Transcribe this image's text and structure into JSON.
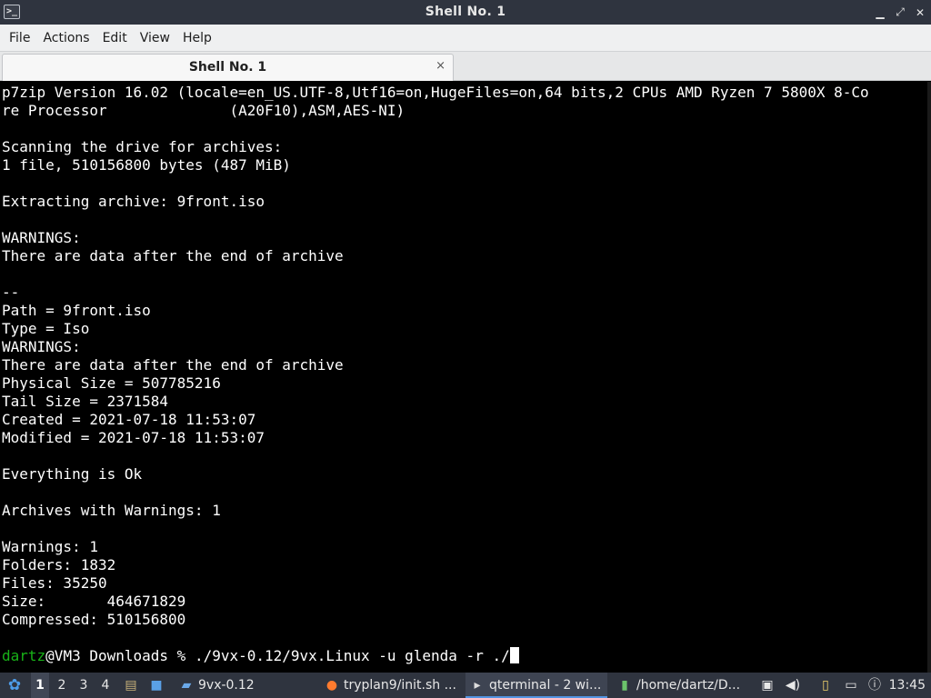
{
  "window": {
    "title": "Shell No. 1"
  },
  "menu": [
    "File",
    "Actions",
    "Edit",
    "View",
    "Help"
  ],
  "tab": {
    "label": "Shell No. 1",
    "close": "×"
  },
  "terminal": {
    "lines": [
      "p7zip Version 16.02 (locale=en_US.UTF-8,Utf16=on,HugeFiles=on,64 bits,2 CPUs AMD Ryzen 7 5800X 8-Co",
      "re Processor              (A20F10),ASM,AES-NI)",
      "",
      "Scanning the drive for archives:",
      "1 file, 510156800 bytes (487 MiB)",
      "",
      "Extracting archive: 9front.iso",
      "",
      "WARNINGS:",
      "There are data after the end of archive",
      "",
      "--",
      "Path = 9front.iso",
      "Type = Iso",
      "WARNINGS:",
      "There are data after the end of archive",
      "Physical Size = 507785216",
      "Tail Size = 2371584",
      "Created = 2021-07-18 11:53:07",
      "Modified = 2021-07-18 11:53:07",
      "",
      "Everything is Ok",
      "",
      "Archives with Warnings: 1",
      "",
      "Warnings: 1",
      "Folders: 1832",
      "Files: 35250",
      "Size:       464671829",
      "Compressed: 510156800",
      ""
    ],
    "prompt_user": "dartz",
    "prompt_rest": "@VM3 Downloads % ",
    "command": "./9vx-0.12/9vx.Linux -u glenda -r ./"
  },
  "taskbar": {
    "workspaces": [
      "1",
      "2",
      "3",
      "4"
    ],
    "tasks": [
      {
        "label": "9vx-0.12",
        "icon": "folder-icon"
      },
      {
        "label": "tryplan9/init.sh ...",
        "icon": "firefox-icon"
      },
      {
        "label": "qterminal - 2 wi...",
        "icon": "terminal-icon"
      },
      {
        "label": "/home/dartz/D...",
        "icon": "file-manager-icon"
      }
    ],
    "clock": "13:45"
  },
  "colors": {
    "titlebar": "#2f343f",
    "prompt_user": "#18b218",
    "accent": "#5294e2"
  }
}
